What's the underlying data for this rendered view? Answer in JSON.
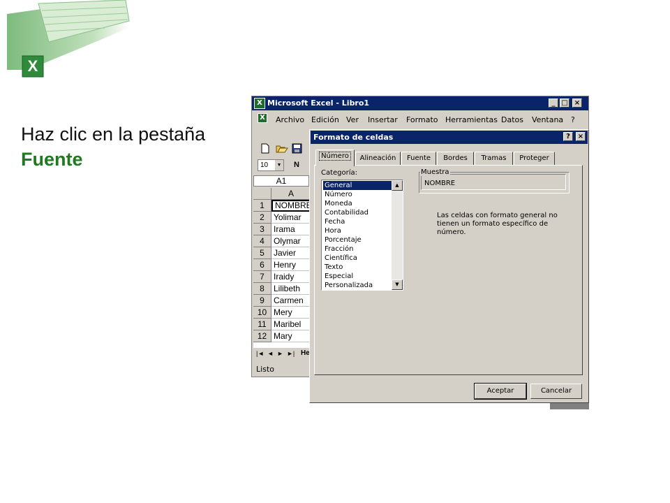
{
  "slide": {
    "line1": "Haz clic en la pestaña",
    "line2": "Fuente"
  },
  "excel": {
    "title": "Microsoft Excel - Libro1",
    "window_buttons": {
      "minimize": "_",
      "maximize": "□",
      "close": "×"
    },
    "menu": [
      "Archivo",
      "Edición",
      "Ver",
      "Insertar",
      "Formato",
      "Herramientas",
      "Datos",
      "Ventana",
      "?"
    ],
    "font_size": "10",
    "bold_label": "N",
    "name_box": "A1",
    "column_header": "A",
    "rows": [
      {
        "n": "1",
        "v": "NOMBRE"
      },
      {
        "n": "2",
        "v": "Yolimar"
      },
      {
        "n": "3",
        "v": "Irama"
      },
      {
        "n": "4",
        "v": "Olymar"
      },
      {
        "n": "5",
        "v": "Javier"
      },
      {
        "n": "6",
        "v": "Henry"
      },
      {
        "n": "7",
        "v": "Iraidy"
      },
      {
        "n": "8",
        "v": "Lilibeth"
      },
      {
        "n": "9",
        "v": "Carmen"
      },
      {
        "n": "10",
        "v": "Mery"
      },
      {
        "n": "11",
        "v": "Maribel"
      },
      {
        "n": "12",
        "v": "Mary"
      }
    ],
    "sheet_tab": "He",
    "status": "Listo"
  },
  "dialog": {
    "title": "Formato de celdas",
    "title_buttons": {
      "help": "?",
      "close": "×"
    },
    "tabs": [
      "Número",
      "Alineación",
      "Fuente",
      "Bordes",
      "Tramas",
      "Proteger"
    ],
    "active_tab": "Número",
    "category_label": "Categoría:",
    "categories": [
      "General",
      "Número",
      "Moneda",
      "Contabilidad",
      "Fecha",
      "Hora",
      "Porcentaje",
      "Fracción",
      "Científica",
      "Texto",
      "Especial",
      "Personalizada"
    ],
    "selected_category": "General",
    "sample_label": "Muestra",
    "sample_value": "NOMBRE",
    "description": "Las celdas con formato general no tienen un formato específico de número.",
    "ok_label": "Aceptar",
    "cancel_label": "Cancelar"
  },
  "colors": {
    "title_bar": "#0a246a",
    "chrome": "#d4d0c8",
    "accent_green": "#1f7a1f"
  }
}
